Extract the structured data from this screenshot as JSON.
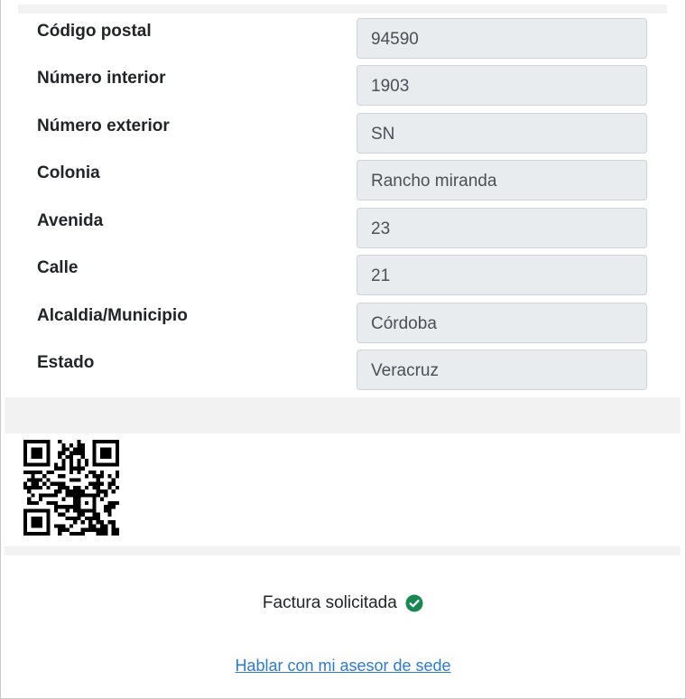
{
  "address_form": {
    "fields": [
      {
        "label": "Código postal",
        "value": "94590"
      },
      {
        "label": "Número interior",
        "value": "1903"
      },
      {
        "label": "Número exterior",
        "value": "SN"
      },
      {
        "label": "Colonia",
        "value": "Rancho miranda"
      },
      {
        "label": "Avenida",
        "value": "23"
      },
      {
        "label": "Calle",
        "value": "21"
      },
      {
        "label": "Alcaldia/Municipio",
        "value": "Córdoba"
      },
      {
        "label": "Estado",
        "value": "Veracruz"
      }
    ]
  },
  "status": {
    "text": "Factura solicitada",
    "icon": "check-circle-icon",
    "color": "#198754"
  },
  "advisor_link": {
    "text": "Hablar con mi asesor de sede"
  },
  "colors": {
    "input_background": "#e9ecef",
    "link": "#2a7ad7",
    "band": "#f2f2f2"
  }
}
